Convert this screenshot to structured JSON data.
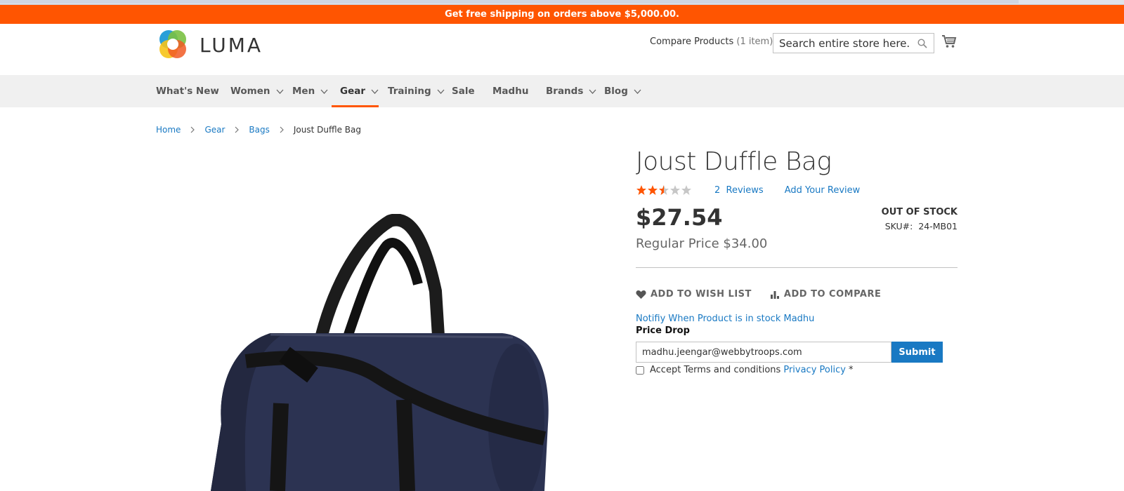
{
  "promo": {
    "text": "Get free shipping on orders above $5,000.00."
  },
  "header": {
    "logo_text": "LUMA",
    "compare_label": "Compare Products",
    "compare_count": "(1 item)",
    "search_placeholder": "Search entire store here..."
  },
  "nav": {
    "items": [
      {
        "label": "What's New"
      },
      {
        "label": "Women"
      },
      {
        "label": "Men"
      },
      {
        "label": "Gear"
      },
      {
        "label": "Training"
      },
      {
        "label": "Sale"
      },
      {
        "label": "Madhu"
      },
      {
        "label": "Brands"
      },
      {
        "label": "Blog"
      }
    ]
  },
  "breadcrumbs": {
    "home": "Home",
    "gear": "Gear",
    "bags": "Bags",
    "current": "Joust Duffle Bag"
  },
  "product": {
    "title": "Joust Duffle Bag",
    "rating_stars": 2.5,
    "rating_max": 5,
    "reviews_count": "2",
    "reviews_label": "Reviews",
    "add_review": "Add Your Review",
    "price": "$27.54",
    "regular_price_label": "Regular Price",
    "regular_price": "$34.00",
    "stock": "Out of stock",
    "sku_label": "SKU#:",
    "sku": "24-MB01",
    "wishlist_label": "ADD TO WISH LIST",
    "compare_label": "ADD TO COMPARE"
  },
  "stock_alert": {
    "notify_link": "Notifiy When Product is in stock Madhu",
    "price_drop_label": "Price Drop",
    "email_value": "madhu.jeengar@webbytroops.com",
    "submit_label": "Submit",
    "terms_label": "Accept Terms and conditions",
    "privacy_label": "Privacy Policy",
    "required_mark": "*"
  },
  "colors": {
    "brand_orange": "#ff5501",
    "link_blue": "#1979c3",
    "nav_bg": "#f0f0f0",
    "bag_navy": "#2c3352"
  }
}
